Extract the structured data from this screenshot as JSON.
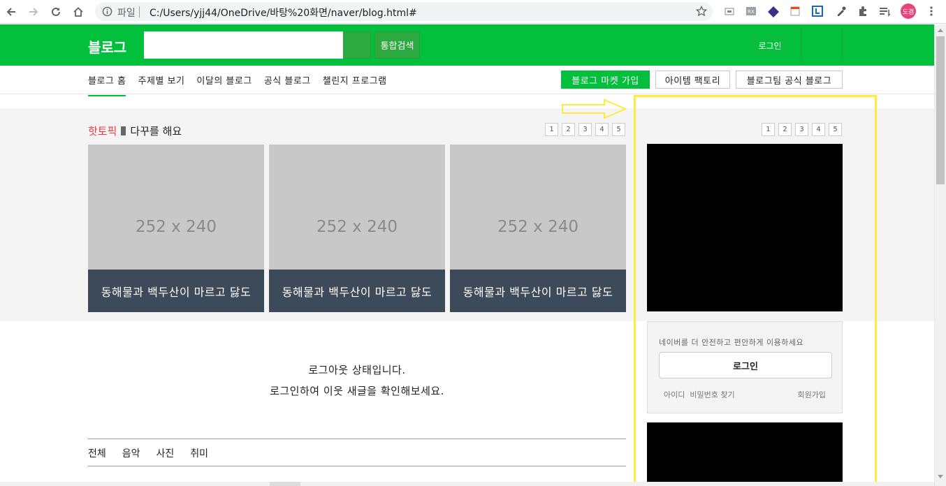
{
  "browser": {
    "scheme_label": "파일",
    "url": "C:/Users/yjj44/OneDrive/바탕%20화면/naver/blog.html#",
    "profile_initials": "도겸",
    "colors": {
      "profile": "#e8457a"
    }
  },
  "header": {
    "logo": "블로그",
    "search_placeholder": "",
    "search_button_label": "통합검색",
    "login_label": "로그인",
    "colors": {
      "brand": "#03c03c"
    }
  },
  "gnb": {
    "menu": [
      "블로그 홈",
      "주제별 보기",
      "이달의 블로그",
      "공식 블로그",
      "챌린지 프로그램"
    ],
    "buttons": [
      "블로그 마켓 가입",
      "아이템 팩토리",
      "블로그팀 공식 블로그"
    ]
  },
  "hot_topic": {
    "label": "핫토픽",
    "subtitle": "다꾸를 해요",
    "pages": [
      "1",
      "2",
      "3",
      "4",
      "5"
    ],
    "cards": [
      {
        "placeholder": "252 x 240",
        "caption": "동해물과 백두산이 마르고 닳도"
      },
      {
        "placeholder": "252 x 240",
        "caption": "동해물과 백두산이 마르고 닳도"
      },
      {
        "placeholder": "252 x 240",
        "caption": "동해물과 백두산이 마르고 닳도"
      }
    ]
  },
  "aside": {
    "pages": [
      "1",
      "2",
      "3",
      "4",
      "5"
    ],
    "login_message": "네이버를 더 안전하고 편안하게 이용하세요",
    "login_button": "로그인",
    "find_links": "아이디  비밀번호 찾기",
    "join_link": "회원가입"
  },
  "logout_notice": {
    "line1": "로그아웃 상태입니다.",
    "line2": "로그인하여 이웃 새글을 확인해보세요."
  },
  "category_tabs": [
    "전체",
    "음악",
    "사진",
    "취미"
  ],
  "annotation": {
    "colors": {
      "highlight": "#ffeb3b"
    }
  }
}
